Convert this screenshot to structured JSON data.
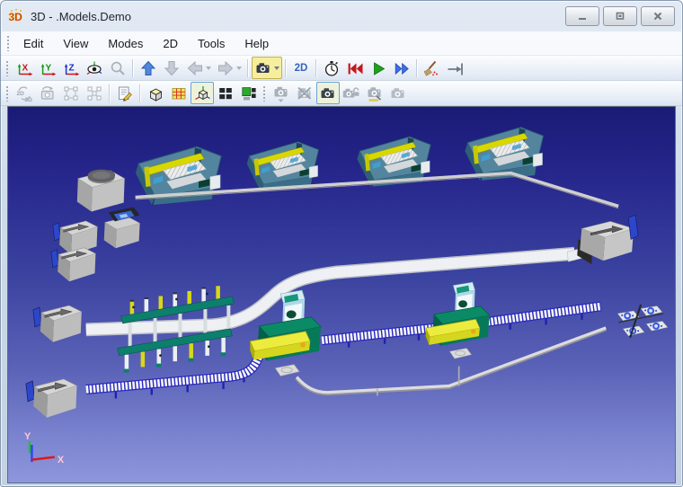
{
  "window": {
    "title": "3D - .Models.Demo",
    "icon_text": "3D",
    "controls": [
      "minimize",
      "restore",
      "close"
    ]
  },
  "menubar": {
    "items": [
      "Edit",
      "View",
      "Modes",
      "2D",
      "Tools",
      "Help"
    ]
  },
  "toolbar_main": {
    "axis_x": "X",
    "axis_y": "Y",
    "axis_z": "Z",
    "label_2d": "2D",
    "buttons": [
      "set-view-x",
      "set-view-y",
      "set-view-z",
      "viewing-mode",
      "zoom",
      "move-up",
      "move-down",
      "back",
      "forward",
      "camera-view",
      "open-2d",
      "event-controller",
      "reset-simulation",
      "start-simulation",
      "fast-forward",
      "reset-contents",
      "step"
    ]
  },
  "toolbar_view": {
    "toggle_top": "2D",
    "toggle_bottom": "3D",
    "buttons": [
      "toggle-2d-3d",
      "snapshot",
      "select-frame",
      "select-nodes",
      "properties",
      "solid-view",
      "show-grid",
      "show-coordinates",
      "tile-windows",
      "new-3d-window",
      "camera-down",
      "camera-delete",
      "camera-standard",
      "camera-unlock",
      "camera-edit",
      "camera-user"
    ]
  },
  "viewport": {
    "axis": {
      "x": "X",
      "y": "Y"
    },
    "background_top": "#1a1a76",
    "background_bottom": "#8e96dc"
  },
  "scene": {
    "objects": [
      "drum-machine",
      "processing-station-1",
      "processing-station-2",
      "processing-station-3",
      "processing-station-4",
      "overhead-rail",
      "source-box-1",
      "source-box-2",
      "small-machine",
      "source-box-3",
      "source-box-4",
      "worker-rack",
      "transport-path",
      "roller-conveyor",
      "assembly-station-1",
      "assembly-station-2",
      "drain-box",
      "pallet-buffer",
      "return-rail"
    ],
    "colors": {
      "station_teal": "#54859e",
      "machine_green": "#0a8a66",
      "accent_yellow": "#e0e020",
      "conveyor_blue": "#2828bc",
      "conveyor_white": "#f4f4f4",
      "path_white": "#eef0f3",
      "box_gray": "#d4d4d4",
      "panel_blue": "#2c46cc",
      "axis_x_red": "#e01818",
      "axis_y_green": "#17c817",
      "axis_z_blue": "#2743ff"
    }
  }
}
